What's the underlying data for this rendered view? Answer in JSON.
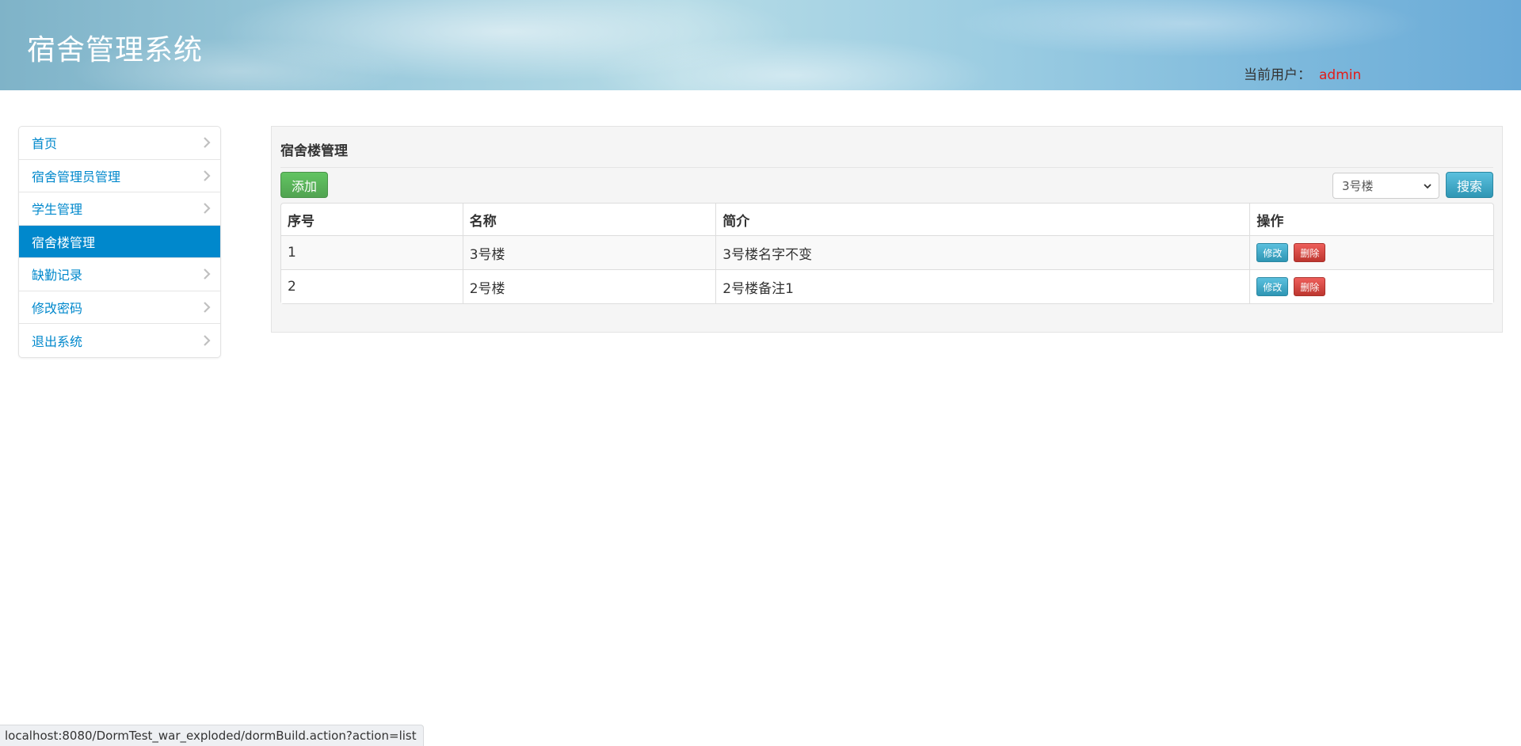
{
  "header": {
    "title": "宿舍管理系统",
    "user_label": "当前用户：",
    "user_name": "admin"
  },
  "sidebar": {
    "items": [
      {
        "label": "首页",
        "active": false
      },
      {
        "label": "宿舍管理员管理",
        "active": false
      },
      {
        "label": "学生管理",
        "active": false
      },
      {
        "label": "宿舍楼管理",
        "active": true
      },
      {
        "label": "缺勤记录",
        "active": false
      },
      {
        "label": "修改密码",
        "active": false
      },
      {
        "label": "退出系统",
        "active": false
      }
    ]
  },
  "main": {
    "title": "宿舍楼管理",
    "add_label": "添加",
    "search_label": "搜索",
    "filter_selected": "3号楼",
    "table": {
      "columns": [
        "序号",
        "名称",
        "简介",
        "操作"
      ],
      "rows": [
        {
          "index": "1",
          "name": "3号楼",
          "desc": "3号楼名字不变",
          "edit": "修改",
          "delete": "删除"
        },
        {
          "index": "2",
          "name": "2号楼",
          "desc": "2号楼备注1",
          "edit": "修改",
          "delete": "删除"
        }
      ]
    }
  },
  "status_bar": {
    "url": "localhost:8080/DormTest_war_exploded/dormBuild.action?action=list"
  },
  "colors": {
    "accent": "#0088cc",
    "add_button": "#5bb75b",
    "info_button": "#49afcd",
    "danger_button": "#da4f49",
    "user_name": "#e41b17"
  },
  "icons": [
    "chevron-right-icon",
    "dropdown-caret-icon"
  ]
}
